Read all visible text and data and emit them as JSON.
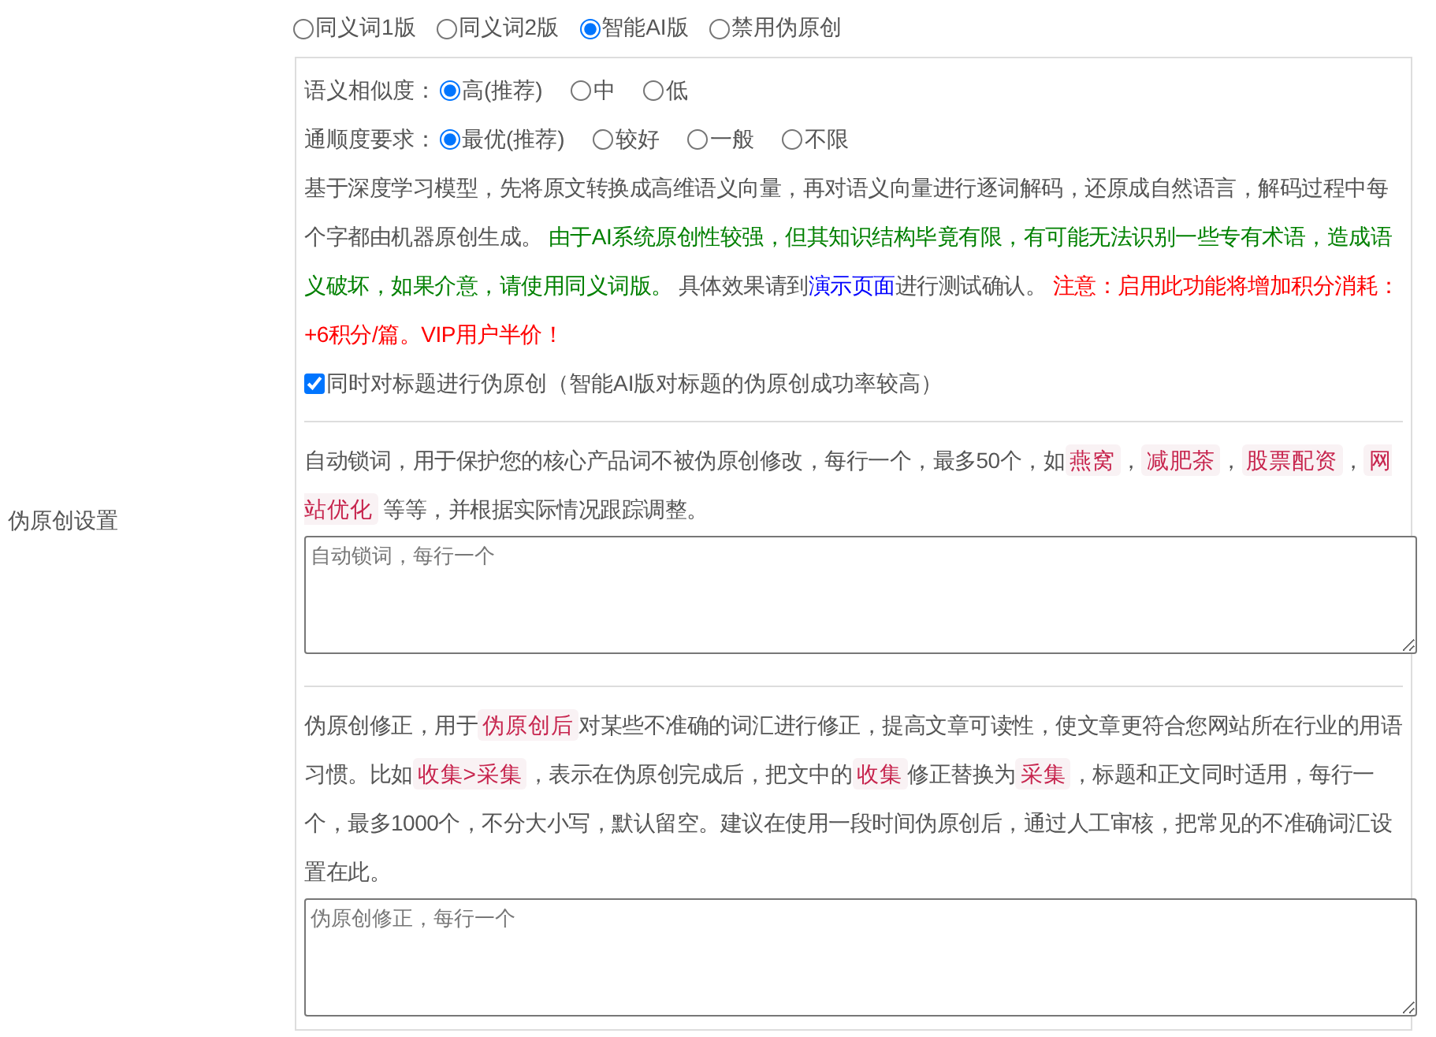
{
  "side_label": "伪原创设置",
  "mode_options": [
    {
      "label": "同义词1版",
      "selected": false
    },
    {
      "label": "同义词2版",
      "selected": false
    },
    {
      "label": "智能AI版",
      "selected": true
    },
    {
      "label": "禁用伪原创",
      "selected": false
    }
  ],
  "similarity": {
    "label": "语义相似度：",
    "options": [
      {
        "label": "高(推荐)",
        "selected": true
      },
      {
        "label": "中",
        "selected": false
      },
      {
        "label": "低",
        "selected": false
      }
    ]
  },
  "fluency": {
    "label": "通顺度要求：",
    "options": [
      {
        "label": "最优(推荐)",
        "selected": true
      },
      {
        "label": "较好",
        "selected": false
      },
      {
        "label": "一般",
        "selected": false
      },
      {
        "label": "不限",
        "selected": false
      }
    ]
  },
  "description": [
    {
      "kind": "plain",
      "text": "基于深度学习模型，先将原文转换成高维语义向量，再对语义向量进行逐词解码，还原成自然语言，解码过程中每个字都由机器原创生成。 "
    },
    {
      "kind": "notice",
      "text": "由于AI系统原创性较强，但其知识结构毕竟有限，有可能无法识别一些专有术语，造成语义破坏，如果介意，请使用同义词版。"
    },
    {
      "kind": "plain",
      "text": " 具体效果请到"
    },
    {
      "kind": "link",
      "text": "演示页面"
    },
    {
      "kind": "plain",
      "text": "进行测试确认。 "
    },
    {
      "kind": "warning",
      "text": "注意：启用此功能将增加积分消耗：+6积分/篇。VIP用户半价！"
    }
  ],
  "title_option": {
    "label": "同时对标题进行伪原创（智能AI版对标题的伪原创成功率较高）",
    "checked": true
  },
  "lock_words": {
    "text": [
      {
        "kind": "plain",
        "text": "自动锁词，用于保护您的核心产品词不被伪原创修改，每行一个，最多50个，如"
      },
      {
        "kind": "tag",
        "text": "燕窝"
      },
      {
        "kind": "plain",
        "text": "，"
      },
      {
        "kind": "tag",
        "text": "减肥茶"
      },
      {
        "kind": "plain",
        "text": "，"
      },
      {
        "kind": "tag",
        "text": "股票配资"
      },
      {
        "kind": "plain",
        "text": "，"
      },
      {
        "kind": "tag",
        "text": "网站优化"
      },
      {
        "kind": "plain",
        "text": " 等等，并根据实际情况跟踪调整。"
      }
    ],
    "placeholder": "自动锁词，每行一个"
  },
  "corrections": {
    "text": [
      {
        "kind": "plain",
        "text": "伪原创修正，用于"
      },
      {
        "kind": "tag",
        "text": "伪原创后"
      },
      {
        "kind": "plain",
        "text": "对某些不准确的词汇进行修正，提高文章可读性，使文章更符合您网站所在行业的用语习惯。比如"
      },
      {
        "kind": "tag",
        "text": "收集>采集"
      },
      {
        "kind": "plain",
        "text": "，表示在伪原创完成后，把文中的"
      },
      {
        "kind": "tag",
        "text": "收集"
      },
      {
        "kind": "plain",
        "text": "修正替换为"
      },
      {
        "kind": "tag",
        "text": "采集"
      },
      {
        "kind": "plain",
        "text": "，标题和正文同时适用，每行一个，最多1000个，不分大小写，默认留空。建议在使用一段时间伪原创后，通过人工审核，把常见的不准确词汇设置在此。"
      }
    ],
    "placeholder": "伪原创修正，每行一个"
  }
}
